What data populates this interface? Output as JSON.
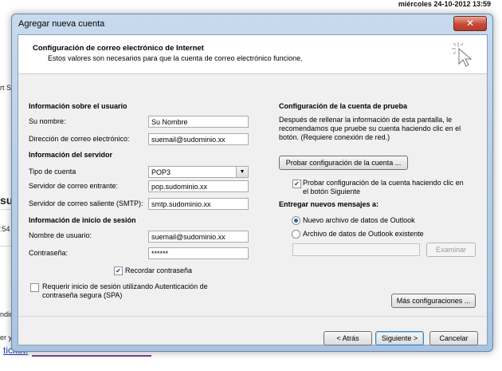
{
  "background": {
    "date_time": "miércoles 24-10-2012 13:59",
    "fragments": [
      "rt Sy",
      "su",
      ":54",
      "ndic",
      "er y",
      "ticket."
    ]
  },
  "window": {
    "title": "Agregar nueva cuenta",
    "close_label": "✕"
  },
  "header": {
    "title": "Configuración de correo electrónico de Internet",
    "subtitle": "Estos valores son necesarios para que la cuenta de correo electrónico funcione."
  },
  "user_info": {
    "heading": "Información sobre el usuario",
    "name_label": "Su nombre:",
    "name_value": "Su Nombre",
    "email_label": "Dirección de correo electrónico:",
    "email_value": "suemail@sudominio.xx"
  },
  "server_info": {
    "heading": "Información del servidor",
    "account_type_label": "Tipo de cuenta",
    "account_type_value": "POP3",
    "incoming_label": "Servidor de correo entrante:",
    "incoming_value": "pop.sudominio.xx",
    "outgoing_label": "Servidor de correo saliente (SMTP):",
    "outgoing_value": "smtp.sudominio.xx"
  },
  "login_info": {
    "heading": "Información de inicio de sesión",
    "username_label": "Nombre de usuario:",
    "username_value": "suemail@sudominio.xx",
    "password_label": "Contraseña:",
    "password_value": "******",
    "remember_label": "Recordar contraseña",
    "remember_checked": true,
    "spa_label_1": "Requerir inicio de sesión utilizando Autenticación de",
    "spa_label_2": "contraseña segura (SPA)",
    "spa_checked": false
  },
  "test_settings": {
    "heading": "Configuración de la cuenta de prueba",
    "description": "Después de rellenar la información de esta pantalla, le recomendamos que pruebe su cuenta haciendo clic en el botón. (Requiere conexión de red.)",
    "test_button": "Probar configuración de la cuenta ...",
    "auto_test_label_1": "Probar configuración de la cuenta haciendo clic en",
    "auto_test_label_2": "el botón Siguiente",
    "auto_test_checked": true
  },
  "delivery": {
    "heading": "Entregar nuevos mensajes a:",
    "option_new": "Nuevo archivo de datos de Outlook",
    "option_existing": "Archivo de datos de Outlook existente",
    "browse_button": "Examinar"
  },
  "buttons": {
    "more_settings": "Más configuraciones ...",
    "back": "< Atrás",
    "next": "Siguiente >",
    "cancel": "Cancelar"
  }
}
